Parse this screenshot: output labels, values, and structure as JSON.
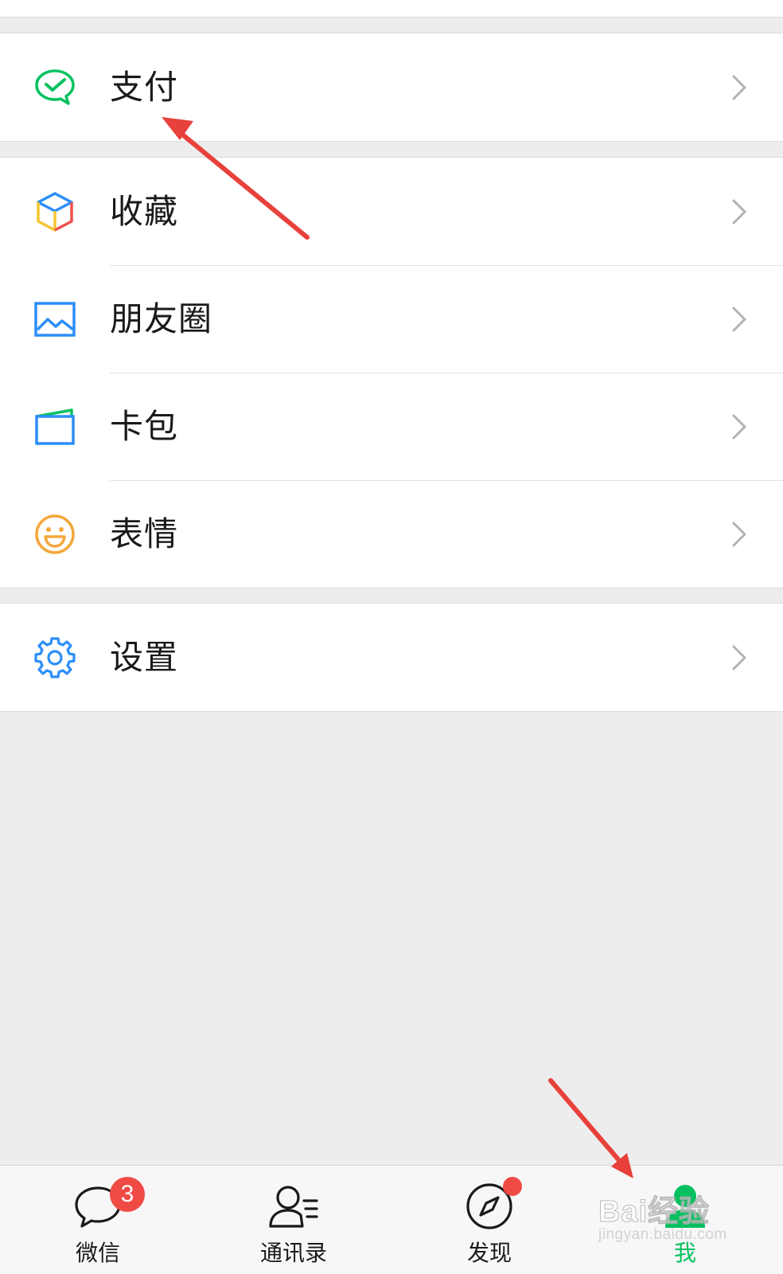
{
  "menu": {
    "group1": [
      {
        "label": "支付",
        "icon": "pay-icon"
      }
    ],
    "group2": [
      {
        "label": "收藏",
        "icon": "favorites-cube-icon"
      },
      {
        "label": "朋友圈",
        "icon": "moments-picture-icon"
      },
      {
        "label": "卡包",
        "icon": "card-wallet-icon"
      },
      {
        "label": "表情",
        "icon": "sticker-smiley-icon"
      }
    ],
    "group3": [
      {
        "label": "设置",
        "icon": "gear-icon"
      }
    ]
  },
  "tabbar": {
    "tabs": [
      {
        "label": "微信",
        "icon": "chat-bubble-icon",
        "badge": "3",
        "active": false
      },
      {
        "label": "通讯录",
        "icon": "contacts-icon",
        "active": false
      },
      {
        "label": "发现",
        "icon": "compass-icon",
        "dot": true,
        "active": false
      },
      {
        "label": "我",
        "icon": "person-icon",
        "active": true
      }
    ]
  },
  "watermark": {
    "logo": "Bai经验",
    "url": "jingyan.baidu.com"
  },
  "colors": {
    "accent_green": "#07c160",
    "badge_red": "#f04a45",
    "annotation_arrow": "#e8413b",
    "background": "#ededed"
  }
}
